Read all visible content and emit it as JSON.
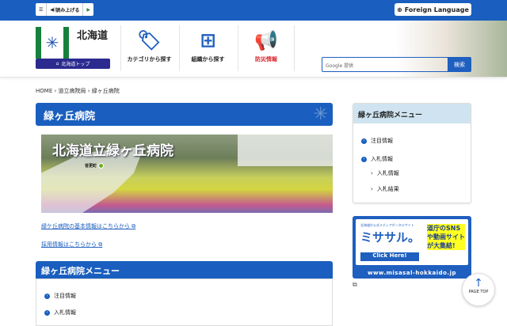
{
  "topbar": {
    "menu_icon": "menu-icon",
    "read_aloud": "読み上げる",
    "foreign_language": "Foreign Language"
  },
  "header": {
    "logo_text": "北海道",
    "home_button": "北海道トップ",
    "nav": [
      {
        "label": "カテゴリから探す",
        "icon": "tag-icon"
      },
      {
        "label": "組織から探す",
        "icon": "org-chart-icon"
      },
      {
        "label": "防災情報",
        "icon": "megaphone-icon"
      }
    ],
    "search_placeholder": "Google 提供",
    "search_button": "検索"
  },
  "breadcrumb": [
    "HOME",
    "道立病院局",
    "緑ヶ丘病院"
  ],
  "page_title": "緑ヶ丘病院",
  "banner": {
    "title": "北海道立緑ヶ丘病院",
    "town": "音更町"
  },
  "links": [
    "緑ケ丘病院の基本情報はこちらから",
    "採用情報はこちらから"
  ],
  "main_menu": {
    "title": "緑ヶ丘病院メニュー",
    "items": [
      "注目情報",
      "入札情報"
    ]
  },
  "side_menu": {
    "title": "緑ヶ丘病院メニュー",
    "items": [
      "注目情報",
      "入札情報"
    ],
    "subitems": [
      "入札情報",
      "入札結果"
    ]
  },
  "ad": {
    "sub": "北海道庁公式メディアポータルサイト",
    "brand": "ミササル。",
    "click": "Click Here!",
    "right": "道庁のSNSや動画サイトが大集結!",
    "url": "www.misasal-hokkaido.jp"
  },
  "page_top": "PAGE TOP",
  "colors": {
    "brand": "#1a5fbf",
    "green": "#16803c",
    "alert": "#d8242a"
  }
}
